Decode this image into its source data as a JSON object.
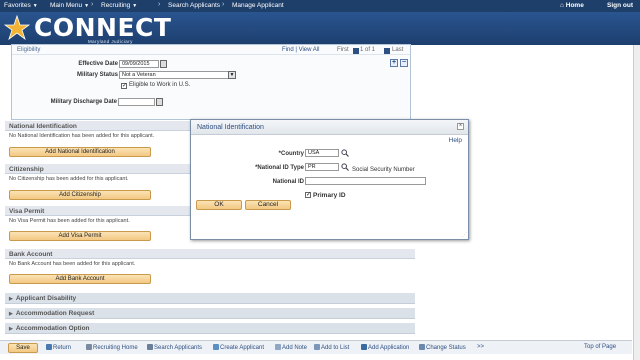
{
  "topnav": {
    "favorites": "Favorites",
    "main_menu": "Main Menu",
    "crumbs": [
      "Recruiting",
      "Search Applicants",
      "Manage Applicant"
    ],
    "home": "Home",
    "sign_out": "Sign out"
  },
  "brand": {
    "name": "CONNECT",
    "sub": "Maryland Judiciary"
  },
  "eligibility": {
    "title": "Eligibility",
    "find": "Find | View All",
    "first": "First",
    "of": "1 of 1",
    "last": "Last",
    "effective_date_label": "Effective Date",
    "effective_date": "09/09/2015",
    "military_status_label": "Military Status",
    "military_status": "Not a Veteran",
    "eligible_label": "Eligible to Work in U.S.",
    "discharge_label": "Military Discharge Date"
  },
  "sections": {
    "national_id": {
      "title": "National Identification",
      "msg": "No National Identification has been added for this applicant.",
      "button": "Add National Identification"
    },
    "citizenship": {
      "title": "Citizenship",
      "msg": "No Citizenship has been added for this applicant.",
      "button": "Add Citizenship"
    },
    "visa": {
      "title": "Visa Permit",
      "msg": "No Visa Permit has been added for this applicant.",
      "button": "Add Visa Permit"
    },
    "bank": {
      "title": "Bank Account",
      "msg": "No Bank Account has been added for this applicant.",
      "button": "Add Bank Account"
    }
  },
  "collapsed": [
    "Applicant Disability",
    "Accommodation Request",
    "Accommodation Option"
  ],
  "modal": {
    "title": "National Identification",
    "help": "Help",
    "country_label": "*Country",
    "country": "USA",
    "id_type_label": "*National ID Type",
    "id_type": "PR",
    "id_type_desc": "Social Security Number",
    "national_id_label": "National ID",
    "national_id": "",
    "primary_label": "Primary ID",
    "ok": "OK",
    "cancel": "Cancel"
  },
  "toolbar": {
    "save": "Save",
    "return": "Return",
    "recruiting_home": "Recruiting Home",
    "search_applicants": "Search Applicants",
    "create_applicant": "Create Applicant",
    "add_note": "Add Note",
    "add_to_list": "Add to List",
    "add_application": "Add Application",
    "change_status": "Change Status",
    "more": ">>",
    "top_of_page": "Top of Page"
  }
}
